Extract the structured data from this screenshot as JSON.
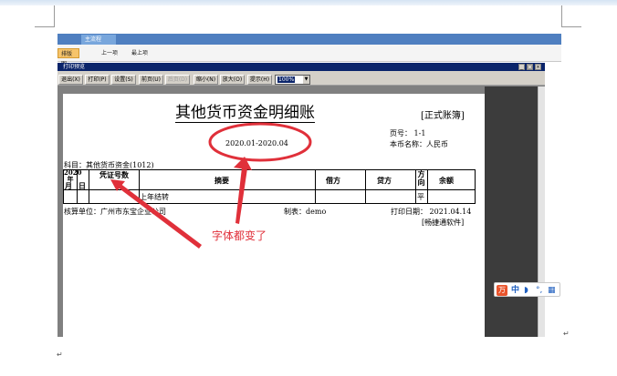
{
  "ribbon": {
    "active_tab": "主流程",
    "active_button": "排版图",
    "prev_button": "上一项",
    "last_button": "最上项"
  },
  "window": {
    "title": "打印预览",
    "controls": [
      "_",
      "□",
      "×"
    ]
  },
  "toolbar": {
    "buttons": [
      "退出(X)",
      "打印(P)",
      "设置(S)",
      "前页(U)",
      "后页(D)",
      "缩小(N)",
      "放大(O)",
      "提示(H)"
    ],
    "disabled": [
      false,
      false,
      false,
      false,
      true,
      false,
      false,
      false
    ],
    "zoom": "100%"
  },
  "report": {
    "title": "其他货币资金明细账",
    "book_type": "[正式账簿]",
    "period": "2020.01-2020.04",
    "page_no": "页号： 1-1",
    "currency": "本币名称：人民币",
    "subject": "科目：其他货币资金(1012)",
    "columns": {
      "year": "2020 年",
      "month": "月",
      "day": "日",
      "voucher": "凭证号数",
      "summary": "摘要",
      "debit": "借方",
      "credit": "贷方",
      "direction": "方向",
      "balance": "余额"
    },
    "row": {
      "summary": "上年结转",
      "direction": "平"
    },
    "footer": {
      "unit": "核算单位：广州市东宝企业公司",
      "maker": "制表：demo",
      "print_date": "打印日期： 2021.04.14",
      "software": "[畅捷通软件]"
    }
  },
  "annotation": {
    "text": "字体都变了",
    "color": "#e0303a"
  },
  "ime": {
    "logo": "万",
    "mode": "中",
    "icons": [
      "moon-icon",
      "punctuation-icon",
      "keyboard-icon"
    ]
  },
  "doc": {
    "paragraph_mark": "↵"
  }
}
